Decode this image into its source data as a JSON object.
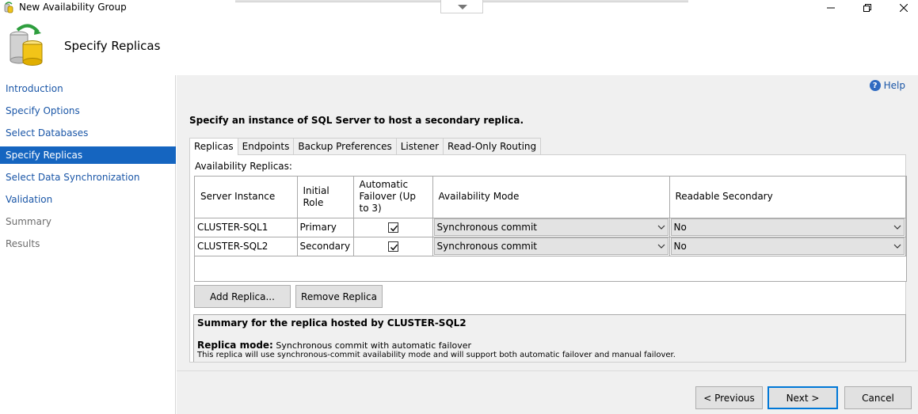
{
  "window": {
    "title": "New Availability Group",
    "controls": [
      "minimize-icon",
      "restore-icon",
      "close-icon"
    ]
  },
  "header": {
    "title": "Specify Replicas",
    "icon": "database-cylinder-icon"
  },
  "nav": {
    "items": [
      {
        "label": "Introduction",
        "state": "link"
      },
      {
        "label": "Specify Options",
        "state": "link"
      },
      {
        "label": "Select Databases",
        "state": "link"
      },
      {
        "label": "Specify Replicas",
        "state": "active"
      },
      {
        "label": "Select Data Synchronization",
        "state": "link"
      },
      {
        "label": "Validation",
        "state": "link"
      },
      {
        "label": "Summary",
        "state": "disabled"
      },
      {
        "label": "Results",
        "state": "disabled"
      }
    ]
  },
  "main": {
    "help_label": "Help",
    "instruction": "Specify an instance of SQL Server to host a secondary replica.",
    "tabs": [
      {
        "label": "Replicas",
        "active": true
      },
      {
        "label": "Endpoints",
        "active": false
      },
      {
        "label": "Backup Preferences",
        "active": false
      },
      {
        "label": "Listener",
        "active": false
      },
      {
        "label": "Read-Only Routing",
        "active": false
      }
    ],
    "replicas_label": "Availability Replicas:",
    "grid": {
      "columns": [
        "Server Instance",
        "Initial Role",
        "Automatic Failover (Up to 3)",
        "Availability Mode",
        "Readable Secondary"
      ],
      "rows": [
        {
          "server": "CLUSTER-SQL1",
          "role": "Primary",
          "auto_failover": true,
          "mode": "Synchronous commit",
          "readable": "No"
        },
        {
          "server": "CLUSTER-SQL2",
          "role": "Secondary",
          "auto_failover": true,
          "mode": "Synchronous commit",
          "readable": "No"
        }
      ]
    },
    "add_replica_label": "Add Replica...",
    "remove_replica_label": "Remove Replica",
    "summary": {
      "title": "Summary for the replica hosted by CLUSTER-SQL2",
      "mode_label": "Replica mode:",
      "mode_value": "Synchronous commit with automatic failover",
      "description": "This replica will use synchronous-commit availability mode and will support both automatic failover and manual failover."
    }
  },
  "footer": {
    "previous_label": "< Previous",
    "next_label": "Next >",
    "cancel_label": "Cancel"
  }
}
